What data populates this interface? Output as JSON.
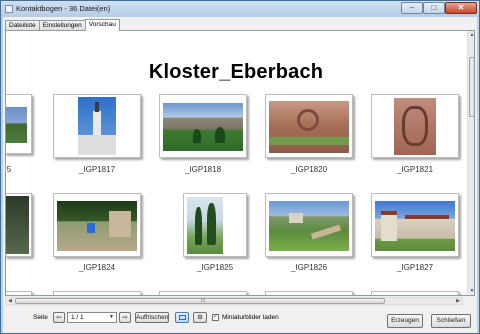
{
  "window": {
    "title": "Kontaktbogen - 36 Datei(en)",
    "controls": {
      "minimize": "–",
      "maximize": "□",
      "close": "✕"
    }
  },
  "tabs": [
    {
      "label": "Dateiliste",
      "active": false
    },
    {
      "label": "Einstellungen",
      "active": false
    },
    {
      "label": "Vorschau",
      "active": true
    }
  ],
  "preview": {
    "title": "Kloster_Eberbach",
    "row1": [
      {
        "caption": "5"
      },
      {
        "caption": "_IGP1817"
      },
      {
        "caption": "_IGP1818"
      },
      {
        "caption": "_IGP1820"
      },
      {
        "caption": "_IGP1821"
      }
    ],
    "row2": [
      {
        "caption": ""
      },
      {
        "caption": "_IGP1824"
      },
      {
        "caption": "_IGP1825"
      },
      {
        "caption": "_IGP1826"
      },
      {
        "caption": "_IGP1827"
      }
    ],
    "scrollbar_grip": "III"
  },
  "toolbar": {
    "page_label": "Seite",
    "prev_icon": "arrow-left-icon",
    "page_value": "1 / 1",
    "next_icon": "arrow-right-icon",
    "refresh_label": "Auffrischen",
    "view_icon": "monitor-icon",
    "settings_icon": "gear-icon",
    "load_thumbnails_checked": true,
    "load_thumbnails_label": "Miniaturbilder laden"
  },
  "buttons": {
    "create": "Erzeugen",
    "close": "Schließen"
  },
  "colors": {
    "accent": "#3c7fc4",
    "window_frame": "#b9d1ea"
  }
}
